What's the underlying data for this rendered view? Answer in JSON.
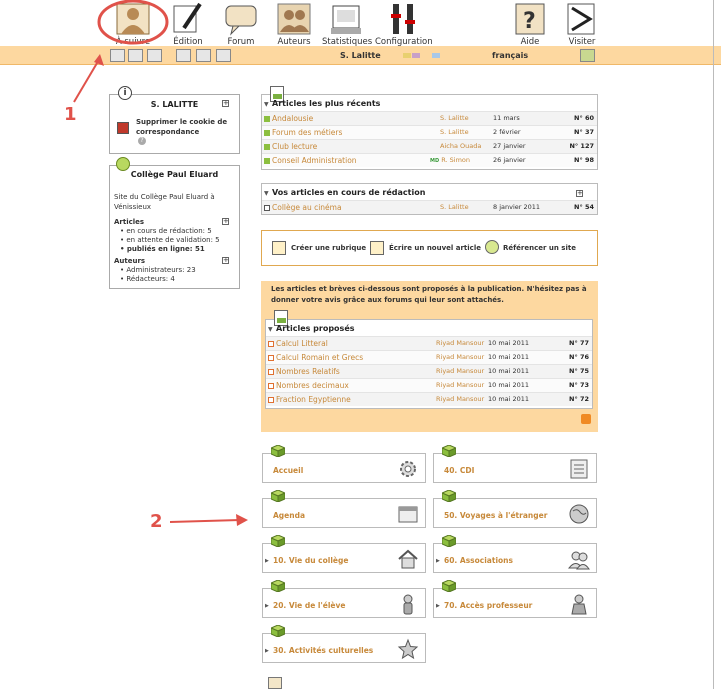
{
  "topnav": {
    "a_suivre": "À suivre",
    "edition": "Édition",
    "forum": "Forum",
    "auteurs": "Auteurs",
    "statistiques": "Statistiques",
    "configuration": "Configuration",
    "aide": "Aide",
    "visiter": "Visiter"
  },
  "subbar": {
    "user": "S. Lalitte",
    "language": "français"
  },
  "user_panel": {
    "title": "S. LALITTE",
    "cookie_link": "Supprimer le cookie de correspondance"
  },
  "site_panel": {
    "title": "Collège Paul Eluard",
    "description": "Site du Collège Paul Eluard à Vénissieux",
    "articles_heading": "Articles",
    "articles": [
      "en cours de rédaction: 5",
      "en attente de validation: 5",
      "publiés en ligne: 51"
    ],
    "auteurs_heading": "Auteurs",
    "auteurs": [
      "Administrateurs: 23",
      "Rédacteurs: 4"
    ]
  },
  "recent": {
    "heading": "Articles les plus récents",
    "rows": [
      {
        "title": "Andalousie",
        "author": "S. Lalitte",
        "date": "11 mars",
        "num": "N° 60"
      },
      {
        "title": "Forum des métiers",
        "author": "S. Lalitte",
        "date": "2 février",
        "num": "N° 37"
      },
      {
        "title": "Club lecture",
        "author": "Aicha Ouada",
        "date": "27 janvier",
        "num": "N° 127"
      },
      {
        "title": "Conseil Administration",
        "author": "R. Simon",
        "date": "26 janvier",
        "num": "N° 98"
      }
    ]
  },
  "inprogress": {
    "heading": "Vos articles en cours de rédaction",
    "rows": [
      {
        "title": "Collège au cinéma",
        "author": "S. Lalitte",
        "date": "8 janvier 2011",
        "num": "N° 54"
      }
    ]
  },
  "actions": {
    "creer": "Créer une rubrique",
    "ecrire": "Écrire un nouvel article",
    "referencer": "Référencer un site"
  },
  "proposed": {
    "notice": "Les articles et brèves ci-dessous sont proposés à la publication. N'hésitez pas à donner votre avis grâce aux forums qui leur sont attachés.",
    "heading": "Articles proposés",
    "rows": [
      {
        "title": "Calcul Litteral",
        "author": "Riyad Mansour",
        "date": "10 mai 2011",
        "num": "N° 77"
      },
      {
        "title": "Calcul Romain et Grecs",
        "author": "Riyad Mansour",
        "date": "10 mai 2011",
        "num": "N° 76"
      },
      {
        "title": "Nombres Relatifs",
        "author": "Riyad Mansour",
        "date": "10 mai 2011",
        "num": "N° 75"
      },
      {
        "title": "Nombres decimaux",
        "author": "Riyad Mansour",
        "date": "10 mai 2011",
        "num": "N° 73"
      },
      {
        "title": "Fraction Egyptienne",
        "author": "Riyad Mansour",
        "date": "10 mai 2011",
        "num": "N° 72"
      }
    ]
  },
  "sections": [
    {
      "title": "Accueil",
      "icon": "gear-icon"
    },
    {
      "title": "40. CDI",
      "icon": "notepad-icon"
    },
    {
      "title": "Agenda",
      "icon": "calendar-icon"
    },
    {
      "title": "50. Voyages à l'étranger",
      "icon": "globe-icon"
    },
    {
      "title": "10. Vie du collège",
      "icon": "house-icon"
    },
    {
      "title": "60. Associations",
      "icon": "people-icon"
    },
    {
      "title": "20. Vie de l'élève",
      "icon": "student-icon"
    },
    {
      "title": "70. Accès professeur",
      "icon": "teacher-icon"
    },
    {
      "title": "30. Activités culturelles",
      "icon": "star-icon"
    }
  ],
  "annotations": {
    "one": "1",
    "two": "2"
  },
  "colors": {
    "accent": "#c7893a",
    "stripe": "#fdd8a0",
    "annotation": "#e0524a",
    "green": "#8cbf3f"
  }
}
